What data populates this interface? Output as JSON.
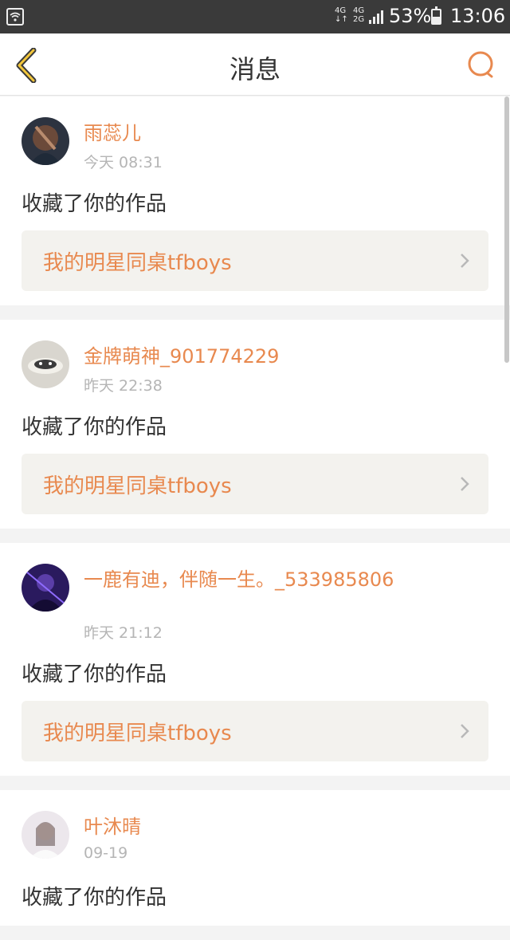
{
  "status_bar": {
    "net_top": "4G",
    "net_top_sub": "↓↑",
    "net_bottom": "4G",
    "net_bottom_sub": "2G",
    "battery_percent": "53%",
    "time": "13:06"
  },
  "nav": {
    "title": "消息",
    "back_icon": "chevron-left-icon",
    "search_icon": "search-icon",
    "accent_color": "#e8894f"
  },
  "messages": [
    {
      "username": "雨蕊儿",
      "time": "今天 08:31",
      "action": "收藏了你的作品",
      "work": "我的明星同桌tfboys"
    },
    {
      "username": "金牌萌神_901774229",
      "time": "昨天 22:38",
      "action": "收藏了你的作品",
      "work": "我的明星同桌tfboys"
    },
    {
      "username": "一鹿有迪，伴随一生。_533985806",
      "time": "昨天 21:12",
      "action": "收藏了你的作品",
      "work": "我的明星同桌tfboys"
    },
    {
      "username": "叶沐晴",
      "time": "09-19",
      "action": "收藏了你的作品",
      "work": ""
    }
  ]
}
